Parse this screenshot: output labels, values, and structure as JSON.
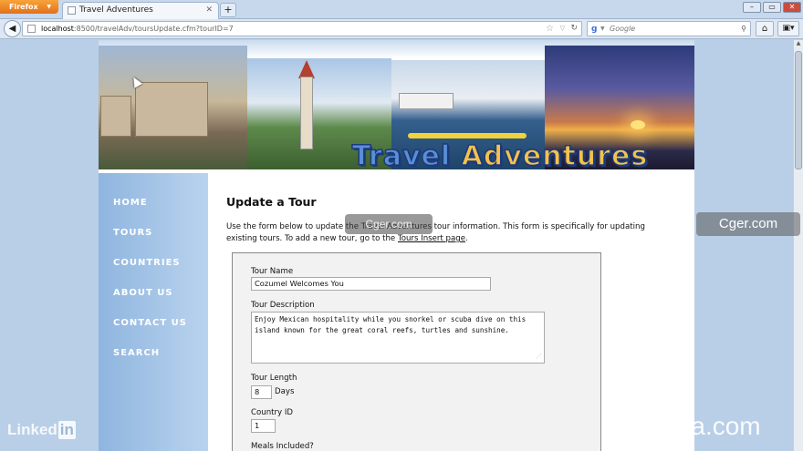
{
  "browser": {
    "app_button": "Firefox",
    "tab_title": "Travel Adventures",
    "url_domain": "localhost",
    "url_rest": ":8500/travelAdv/toursUpdate.cfm?tourID=7",
    "search_placeholder": "Google"
  },
  "site": {
    "logo_text_1": "Travel",
    "logo_text_2": "Adventures",
    "nav": [
      "HOME",
      "TOURS",
      "COUNTRIES",
      "ABOUT US",
      "CONTACT US",
      "SEARCH"
    ]
  },
  "page": {
    "title": "Update a Tour",
    "intro_before_link": "Use the form below to update the Travel Adventures tour information. This form is specifically for updating existing tours. To add a new tour, go to the ",
    "intro_link": "Tours Insert page",
    "intro_after_link": "."
  },
  "form": {
    "tour_name_label": "Tour Name",
    "tour_name_value": "Cozumel Welcomes You",
    "tour_description_label": "Tour Description",
    "tour_description_value": "Enjoy Mexican hospitality while you snorkel or scuba dive on this island known for the great coral reefs, turtles and sunshine.",
    "tour_length_label": "Tour Length",
    "tour_length_value": "8",
    "tour_length_suffix": "Days",
    "country_id_label": "Country ID",
    "country_id_value": "1",
    "meals_label": "Meals Included?"
  },
  "watermarks": {
    "cger": "Cger.com",
    "linkedin": "Linked",
    "linkedin_in": "in",
    "lynda": "lynda.com"
  }
}
